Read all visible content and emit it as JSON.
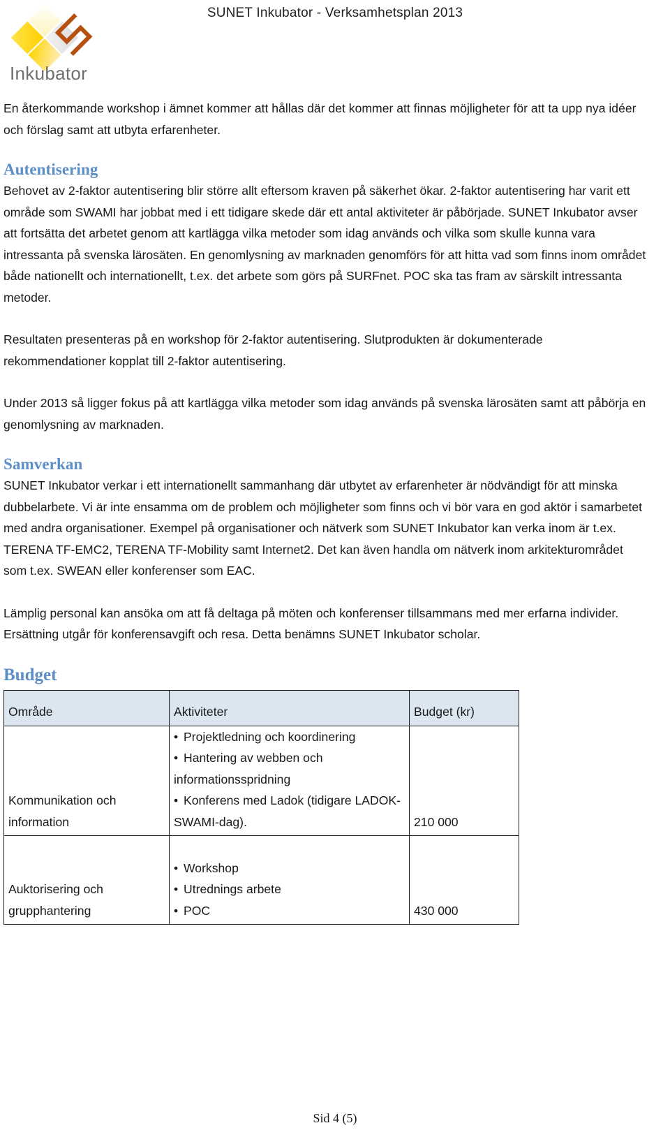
{
  "header": {
    "title": "SUNET Inkubator - Verksamhetsplan 2013",
    "logo_text": "Inkubator",
    "logo_icon": "inkubator-diamond-s-logo"
  },
  "body": {
    "intro_paragraph": "En återkommande workshop i ämnet kommer att hållas där det kommer att finnas möjligheter för att ta upp nya idéer och förslag samt att utbyta erfarenheter.",
    "sections": [
      {
        "heading": "Autentisering",
        "paragraphs": [
          "Behovet av 2-faktor autentisering blir större allt eftersom kraven på säkerhet ökar. 2-faktor autentisering har varit ett område som SWAMI har jobbat med i ett tidigare skede där ett antal aktiviteter är påbörjade. SUNET Inkubator avser att fortsätta det arbetet genom att kartlägga vilka metoder som idag används och vilka som skulle kunna vara intressanta på svenska lärosäten. En genomlysning av marknaden genomförs för att hitta vad som finns inom området både nationellt och internationellt, t.ex. det arbete som görs på SURFnet. POC ska tas fram av särskilt intressanta metoder.",
          "Resultaten presenteras på en workshop för 2-faktor autentisering. Slutprodukten är dokumenterade rekommendationer kopplat till 2-faktor autentisering.",
          "Under 2013 så ligger fokus på att kartlägga vilka metoder som idag används på svenska lärosäten samt att påbörja en genomlysning av marknaden."
        ]
      },
      {
        "heading": "Samverkan",
        "paragraphs": [
          "SUNET Inkubator verkar i ett internationellt sammanhang där utbytet av erfarenheter är nödvändigt för att minska dubbelarbete. Vi är inte ensamma om de problem och möjligheter som finns och vi bör vara en god aktör i samarbetet med andra organisationer. Exempel på organisationer och nätverk som SUNET Inkubator kan verka inom är t.ex. TERENA TF-EMC2, TERENA TF-Mobility samt  Internet2. Det kan även handla om nätverk inom arkitekturområdet som t.ex. SWEAN eller konferenser som EAC.",
          "Lämplig personal kan ansöka om att få deltaga på möten och konferenser tillsammans med mer erfarna individer. Ersättning utgår för konferensavgift och resa. Detta benämns SUNET Inkubator scholar."
        ]
      }
    ]
  },
  "budget": {
    "heading": "Budget",
    "columns": [
      "Område",
      "Aktiviteter",
      "Budget (kr)"
    ],
    "rows": [
      {
        "area": "Kommunikation och information",
        "activities": [
          "Projektledning och koordinering",
          "Hantering av webben och informationsspridning",
          "Konferens med Ladok (tidigare LADOK-SWAMI-dag)."
        ],
        "amount": "210 000"
      },
      {
        "area": "Auktorisering och grupphantering",
        "activities": [
          "Workshop",
          "Utrednings arbete",
          "POC"
        ],
        "amount": "430 000"
      }
    ]
  },
  "footer": {
    "page_label": "Sid 4 (5)"
  },
  "colors": {
    "heading_blue": "#5b8ec4",
    "table_header_bg": "#dce6f1",
    "logo_yellow": "#ffd400",
    "logo_orange": "#b5500f",
    "logo_text_gray": "#6f6f70"
  }
}
